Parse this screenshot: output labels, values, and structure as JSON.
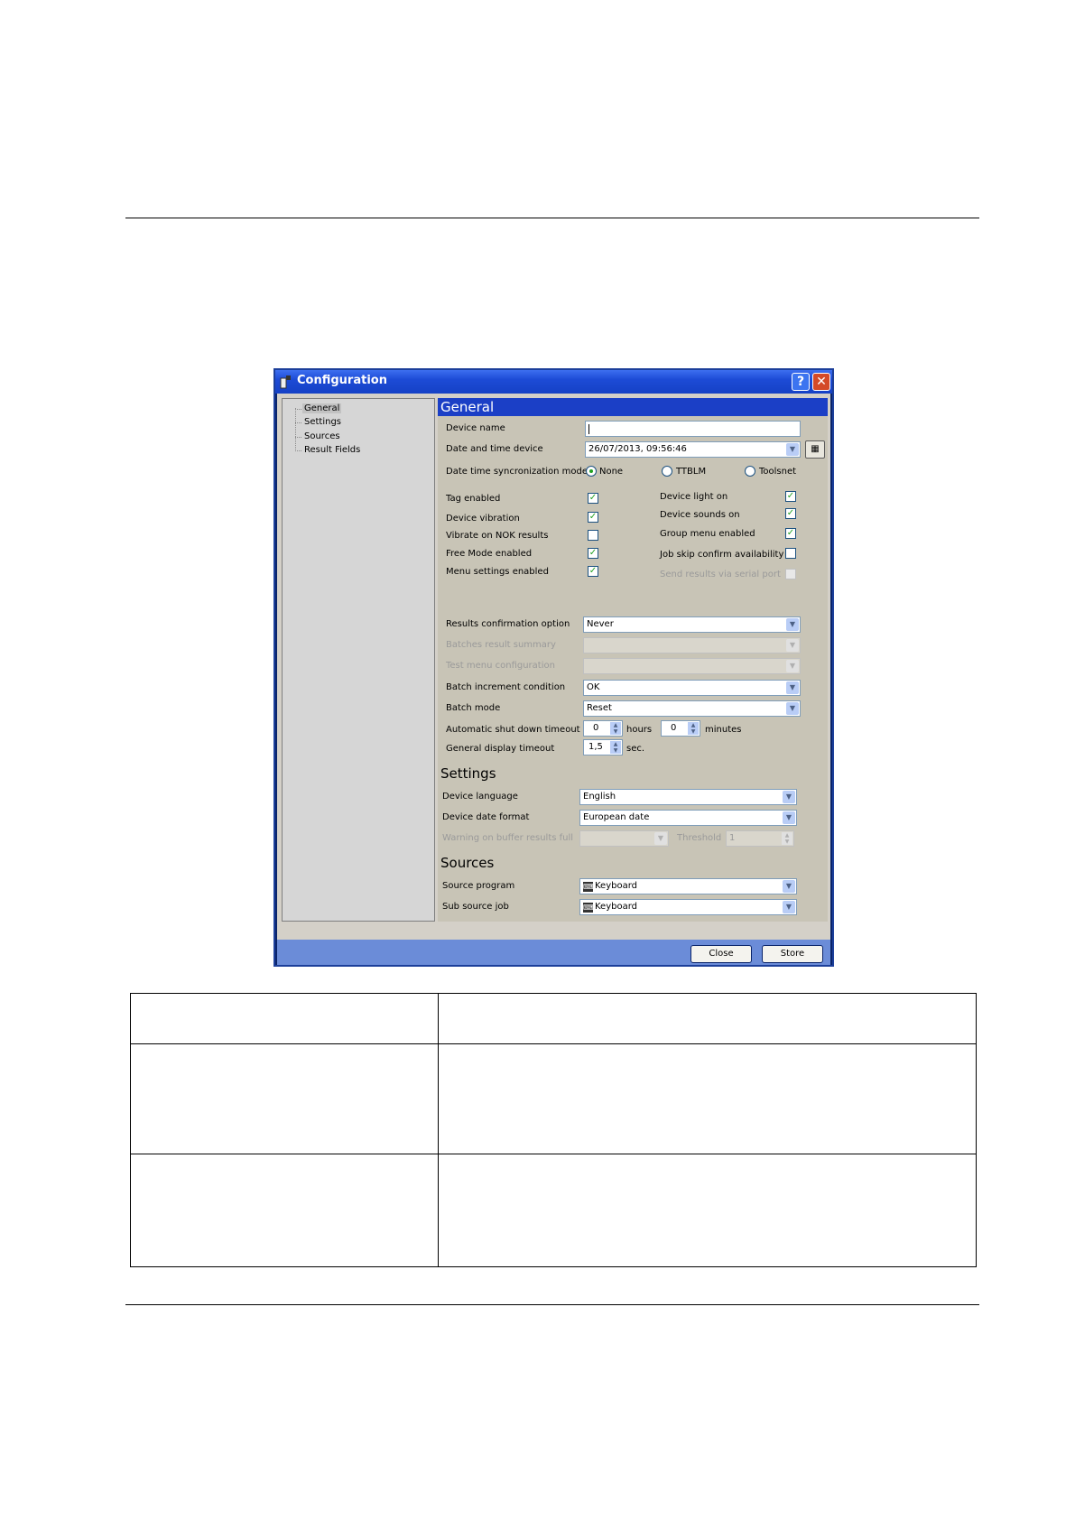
{
  "window": {
    "title": "Configuration",
    "help_label": "?",
    "close_label": "✕"
  },
  "tree": {
    "items": [
      {
        "label": "General",
        "selected": true
      },
      {
        "label": "Settings"
      },
      {
        "label": "Sources"
      },
      {
        "label": "Result Fields"
      }
    ]
  },
  "general": {
    "header": "General",
    "device_name": {
      "label": "Device name",
      "value": ""
    },
    "date_time_device": {
      "label": "Date and time device",
      "value": "26/07/2013, 09:56:46"
    },
    "sync_mode": {
      "label": "Date time syncronization mode",
      "options": [
        {
          "label": "None",
          "selected": true
        },
        {
          "label": "TTBLM",
          "selected": false
        },
        {
          "label": "Toolsnet",
          "selected": false
        }
      ]
    },
    "checkboxes_left": [
      {
        "label": "Tag enabled",
        "checked": true
      },
      {
        "label": "Device vibration",
        "checked": true
      },
      {
        "label": "Vibrate on NOK results",
        "checked": false
      },
      {
        "label": "Free Mode enabled",
        "checked": true
      },
      {
        "label": "Menu settings enabled",
        "checked": true
      }
    ],
    "checkboxes_right": [
      {
        "label": "Device light on",
        "checked": true
      },
      {
        "label": "Device sounds on",
        "checked": true
      },
      {
        "label": "Group menu enabled",
        "checked": true
      },
      {
        "label": "Job skip confirm availability",
        "checked": false
      },
      {
        "label": "Send results via serial port",
        "checked": false,
        "disabled": true
      }
    ],
    "results_confirmation": {
      "label": "Results confirmation option",
      "value": "Never"
    },
    "batches_result_summary": {
      "label": "Batches result summary",
      "value": ""
    },
    "test_menu_configuration": {
      "label": "Test menu configuration",
      "value": ""
    },
    "batch_increment_condition": {
      "label": "Batch increment condition",
      "value": "OK"
    },
    "batch_mode": {
      "label": "Batch mode",
      "value": "Reset"
    },
    "auto_shutdown": {
      "label": "Automatic shut down timeout",
      "hours": "0",
      "hours_unit": "hours",
      "minutes": "0",
      "minutes_unit": "minutes"
    },
    "display_timeout": {
      "label": "General display timeout",
      "value": "1,5",
      "unit": "sec."
    }
  },
  "settings": {
    "title": "Settings",
    "device_language": {
      "label": "Device language",
      "value": "English"
    },
    "device_date_format": {
      "label": "Device date format",
      "value": "European date"
    },
    "warning_buffer": {
      "label": "Warning on buffer results full",
      "value": "",
      "threshold_label": "Threshold",
      "threshold_value": "1"
    }
  },
  "sources": {
    "title": "Sources",
    "source_program": {
      "label": "Source program",
      "value": "Keyboard"
    },
    "sub_source_job": {
      "label": "Sub source job",
      "value": "Keyboard"
    }
  },
  "footer": {
    "close_label": "Close",
    "store_label": "Store"
  },
  "colors": {
    "titlebar": "#1d4bd6",
    "section_header": "#1b3fc6",
    "panel": "#c8c4b6",
    "check": "#21a121"
  }
}
